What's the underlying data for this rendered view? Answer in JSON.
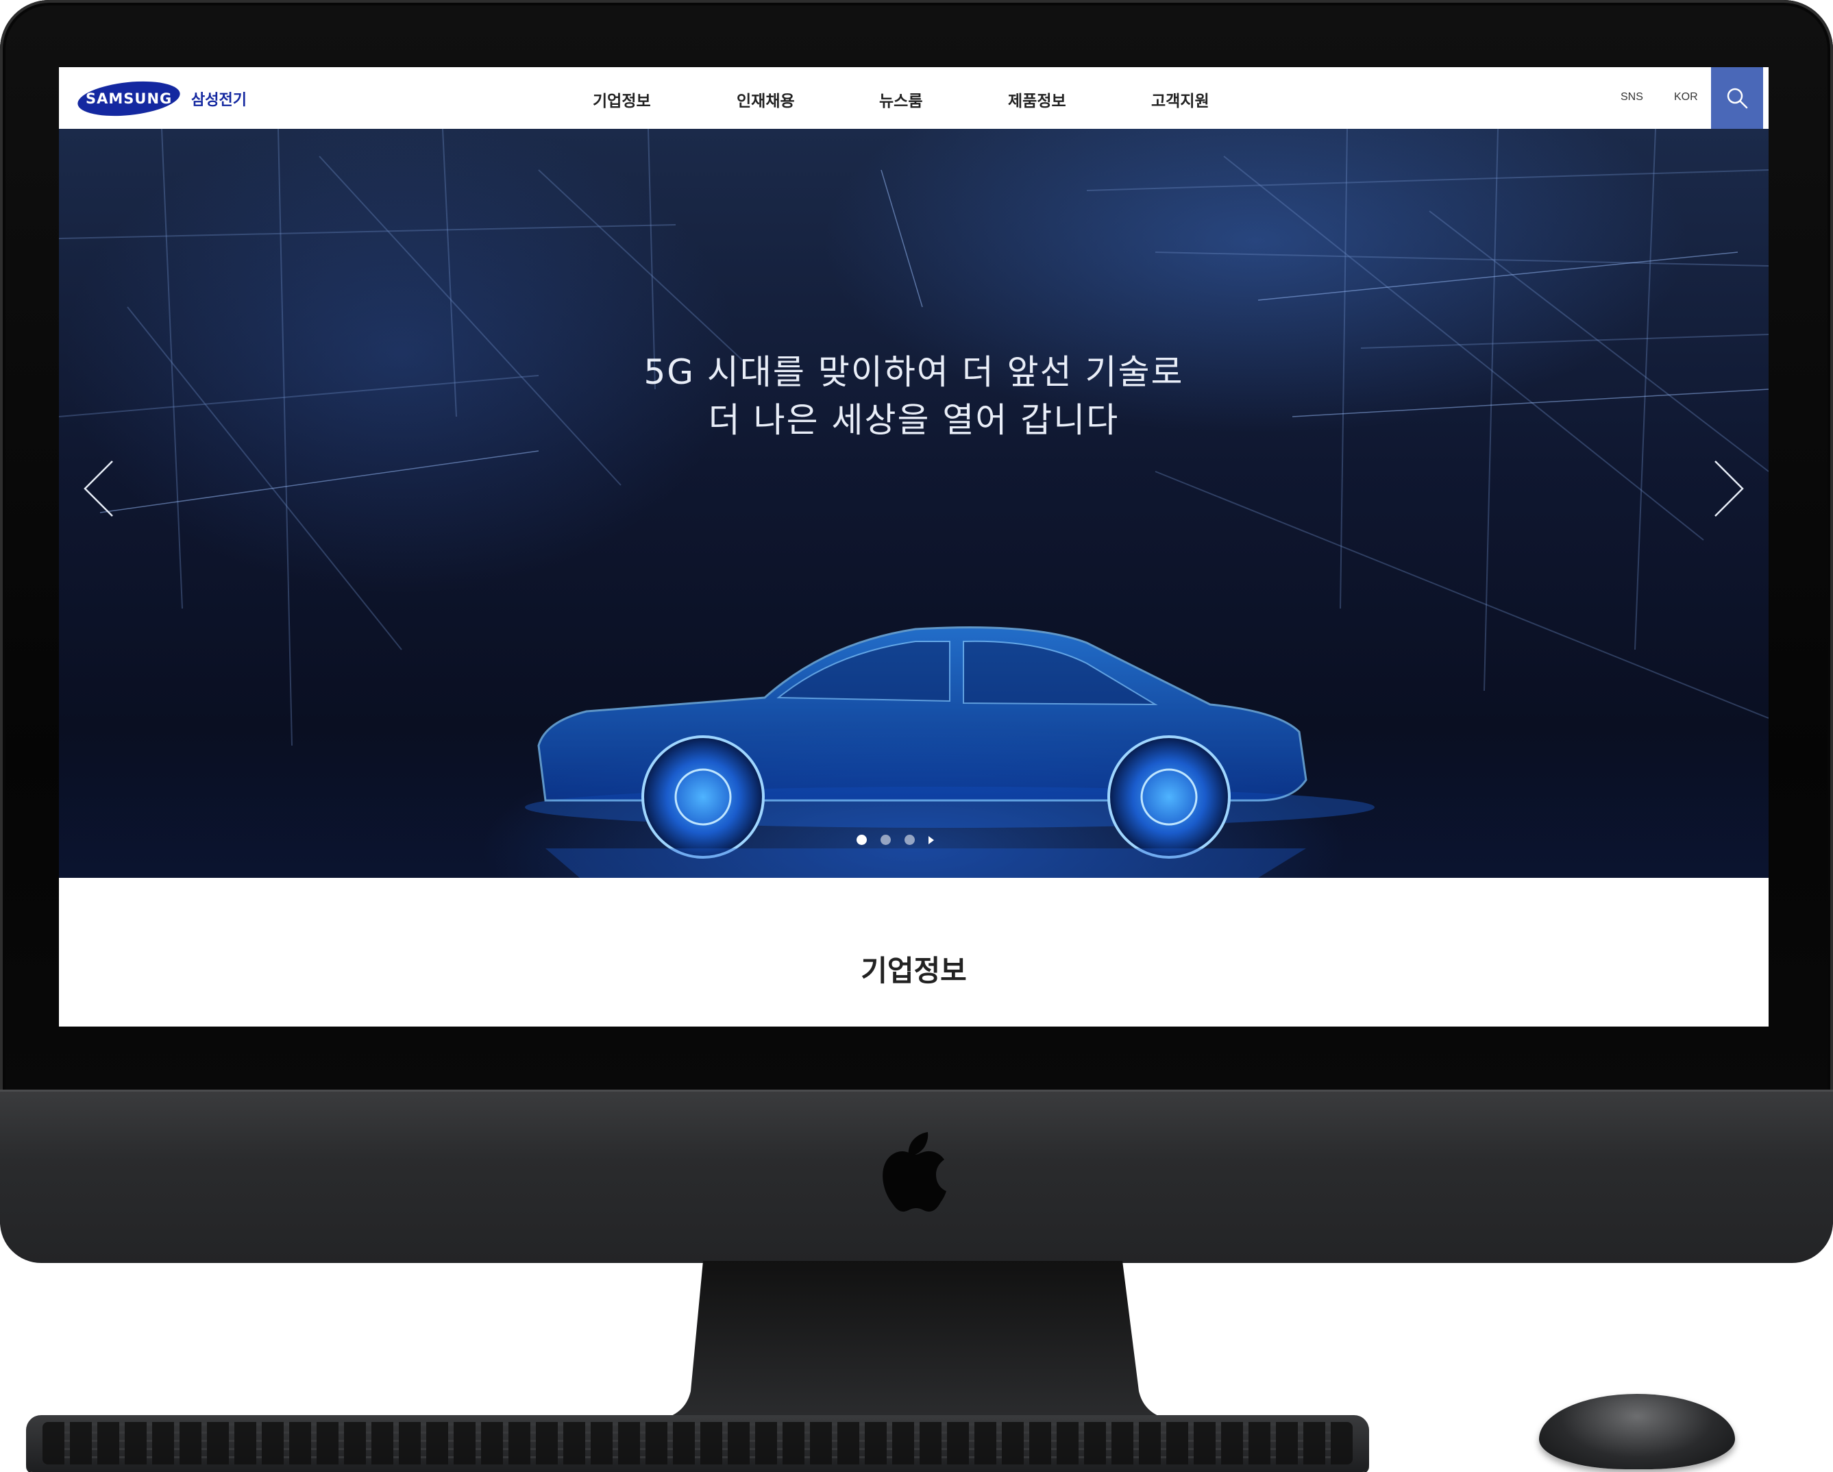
{
  "header": {
    "logo_wordmark": "SAMSUNG",
    "logo_text": "삼성전기",
    "nav": [
      "기업정보",
      "인재채용",
      "뉴스룸",
      "제품정보",
      "고객지원"
    ],
    "sns_label": "SNS",
    "lang_label": "KOR",
    "search_icon": "search-icon"
  },
  "hero": {
    "title_line1": "5G 시대를 맞이하여 더 앞선 기술로",
    "title_line2": "더 나은 세상을 열어 갑니다",
    "prev_icon": "chevron-left-icon",
    "next_icon": "chevron-right-icon",
    "slide_count": 3,
    "active_slide": 1
  },
  "section": {
    "title": "기업정보"
  },
  "colors": {
    "brand": "#1428a0",
    "search_bg": "#4a68b8"
  }
}
